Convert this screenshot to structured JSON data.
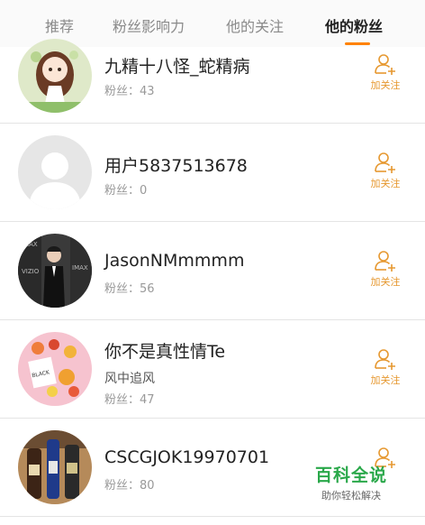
{
  "tabs": [
    {
      "label": "推荐"
    },
    {
      "label": "粉丝影响力"
    },
    {
      "label": "他的关注"
    },
    {
      "label": "他的粉丝"
    }
  ],
  "active_tab": "他的粉丝",
  "follow_label": "加关注",
  "users": [
    {
      "name": "九精十八怪_蛇精病",
      "fans": "粉丝：43",
      "avatar": "illustrated-girl-avatar"
    },
    {
      "name": "用户5837513678",
      "fans": "粉丝：0",
      "avatar": "default-person-avatar"
    },
    {
      "name": "JasonNMmmmm",
      "fans": "粉丝：56",
      "avatar": "event-photo-avatar"
    },
    {
      "name": "你不是真性情Te",
      "subtitle": "风中追风",
      "fans": "粉丝：47",
      "avatar": "pink-collage-avatar"
    },
    {
      "name": "CSCGJOK19970701",
      "fans": "粉丝：80",
      "avatar": "bottles-avatar"
    }
  ],
  "watermark": {
    "title": "百科全说",
    "subtitle": "助你轻松解决"
  },
  "colors": {
    "accent": "#ff8200",
    "follow": "#e69830",
    "watermark": "#2aa84a"
  }
}
